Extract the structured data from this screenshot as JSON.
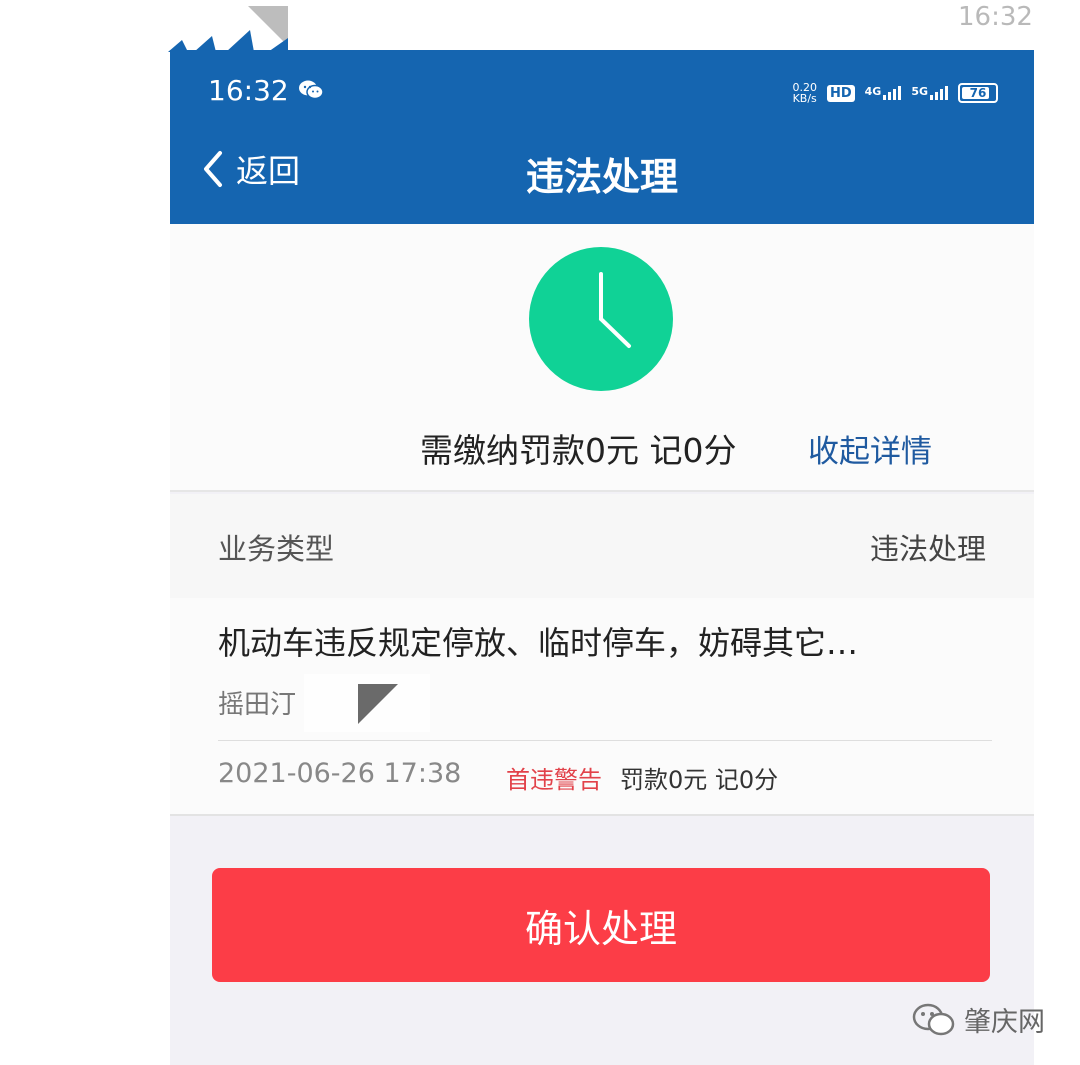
{
  "outer": {
    "time": "16:32"
  },
  "status_bar": {
    "time": "16:32",
    "net_speed_value": "0.20",
    "net_speed_unit": "KB/s",
    "hd_label": "HD",
    "net1_label": "4G",
    "net2_label": "5G",
    "battery_level": "76"
  },
  "nav": {
    "back_label": "返回",
    "title": "违法处理"
  },
  "summary": {
    "fine_text": "需缴纳罚款0元 记0分",
    "collapse_label": "收起详情",
    "icon_color": "#10d296"
  },
  "business": {
    "label": "业务类型",
    "value": "违法处理"
  },
  "record": {
    "title": "机动车违反规定停放、临时停车，妨碍其它…",
    "location": "摇田汀",
    "date": "2021-06-26 17:38",
    "warning": "首违警告",
    "fine": "罚款0元 记0分"
  },
  "actions": {
    "confirm_label": "确认处理"
  },
  "watermark": {
    "label": "肇庆网"
  },
  "colors": {
    "header": "#1565b0",
    "accent_link": "#1f5aa0",
    "button": "#fc3d47",
    "warning": "#e2424a"
  }
}
